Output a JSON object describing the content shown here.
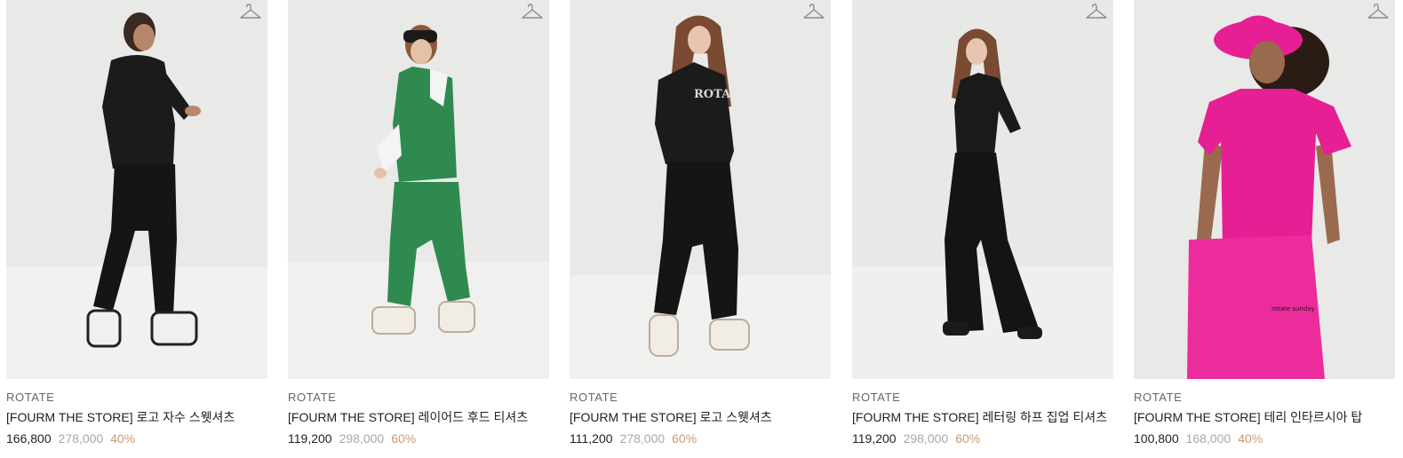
{
  "products": [
    {
      "brand": "ROTATE",
      "name": "[FOURM THE STORE] 로고 자수 스웻셔츠",
      "price": "166,800",
      "original_price": "278,000",
      "discount": "40%",
      "image": "model in black logo sweatshirt and black sweatpants with sneakers",
      "icon": "hanger-icon"
    },
    {
      "brand": "ROTATE",
      "name": "[FOURM THE STORE] 레이어드 후드 티셔츠",
      "price": "119,200",
      "original_price": "298,000",
      "discount": "60%",
      "image": "model in green layered hoodie and green sweatpants with headband",
      "icon": "hanger-icon"
    },
    {
      "brand": "ROTATE",
      "name": "[FOURM THE STORE] 로고 스웻셔츠",
      "price": "111,200",
      "original_price": "278,000",
      "discount": "60%",
      "image": "model in black logo sweatshirt and black joggers with cream sneakers",
      "icon": "hanger-icon"
    },
    {
      "brand": "ROTATE",
      "name": "[FOURM THE STORE] 레터링 하프 집업 티셔츠",
      "price": "119,200",
      "original_price": "298,000",
      "discount": "60%",
      "image": "model in black half zip-up top and wide black pants",
      "icon": "hanger-icon"
    },
    {
      "brand": "ROTATE",
      "name": "[FOURM THE STORE] 테리 인타르시아 탑",
      "price": "100,800",
      "original_price": "168,000",
      "discount": "40%",
      "image": "model in pink terry top, pink bucket hat and pink pants",
      "icon": "hanger-icon"
    }
  ],
  "colors": {
    "price": "#222222",
    "original_price": "#a8a8a8",
    "discount": "#c99c72",
    "brand": "#666666",
    "photo_background": "#e9e9e7"
  }
}
